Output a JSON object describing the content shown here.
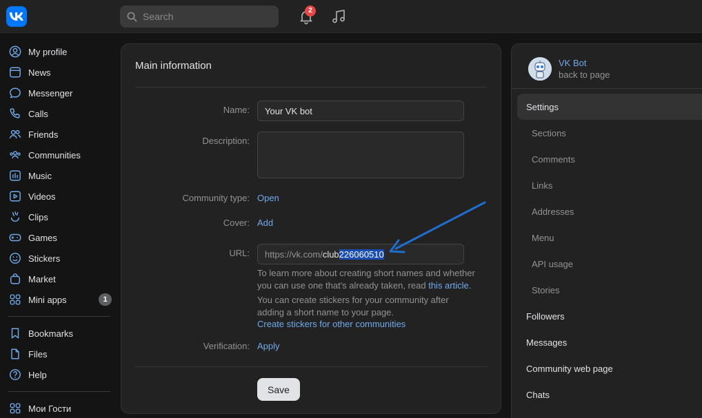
{
  "topbar": {
    "logo": "vk-logo",
    "search_placeholder": "Search",
    "notifications_count": "2"
  },
  "sidebar": {
    "items": [
      {
        "label": "My profile",
        "icon": "user-circle-icon"
      },
      {
        "label": "News",
        "icon": "news-icon"
      },
      {
        "label": "Messenger",
        "icon": "chat-icon"
      },
      {
        "label": "Calls",
        "icon": "phone-icon"
      },
      {
        "label": "Friends",
        "icon": "friends-icon"
      },
      {
        "label": "Communities",
        "icon": "communities-icon"
      },
      {
        "label": "Music",
        "icon": "music-icon"
      },
      {
        "label": "Videos",
        "icon": "video-icon"
      },
      {
        "label": "Clips",
        "icon": "clips-icon"
      },
      {
        "label": "Games",
        "icon": "gamepad-icon"
      },
      {
        "label": "Stickers",
        "icon": "smile-icon"
      },
      {
        "label": "Market",
        "icon": "bag-icon"
      },
      {
        "label": "Mini apps",
        "icon": "grid-icon",
        "count": "1"
      }
    ],
    "items2": [
      {
        "label": "Bookmarks",
        "icon": "bookmark-icon"
      },
      {
        "label": "Files",
        "icon": "file-icon"
      },
      {
        "label": "Help",
        "icon": "help-icon"
      }
    ],
    "items3": [
      {
        "label": "Мои Гости",
        "icon": "grid-icon"
      }
    ]
  },
  "main": {
    "title": "Main information",
    "name_label": "Name:",
    "name_value": "Your VK bot",
    "description_label": "Description:",
    "description_value": "",
    "community_type_label": "Community type:",
    "community_type_value": "Open",
    "cover_label": "Cover:",
    "cover_value": "Add",
    "url_label": "URL:",
    "url_prefix": "https://vk.com/",
    "url_value_plain": "club",
    "url_value_selected": "226060510",
    "hint1_text": "To learn more about creating short names and whether you can use one that's already taken, read",
    "hint1_link": "this article",
    "hint1_end": ".",
    "hint2_text": "You can create stickers for your community after adding a short name to your page.",
    "hint2_link": "Create stickers for other communities",
    "verification_label": "Verification:",
    "verification_value": "Apply",
    "save_label": "Save"
  },
  "right": {
    "bot_name": "VK Bot",
    "back_label": "back to page",
    "menu": [
      {
        "label": "Settings",
        "type": "active"
      },
      {
        "label": "Sections",
        "type": "sub"
      },
      {
        "label": "Comments",
        "type": "sub"
      },
      {
        "label": "Links",
        "type": "sub"
      },
      {
        "label": "Addresses",
        "type": "sub"
      },
      {
        "label": "Menu",
        "type": "sub"
      },
      {
        "label": "API usage",
        "type": "sub"
      },
      {
        "label": "Stories",
        "type": "sub"
      },
      {
        "label": "Followers",
        "type": "main"
      },
      {
        "label": "Messages",
        "type": "main"
      },
      {
        "label": "Community web page",
        "type": "main"
      },
      {
        "label": "Chats",
        "type": "main"
      }
    ]
  },
  "colors": {
    "accent": "#71aaeb",
    "brand": "#0077ff",
    "annotation_arrow": "#1f6fd0"
  }
}
